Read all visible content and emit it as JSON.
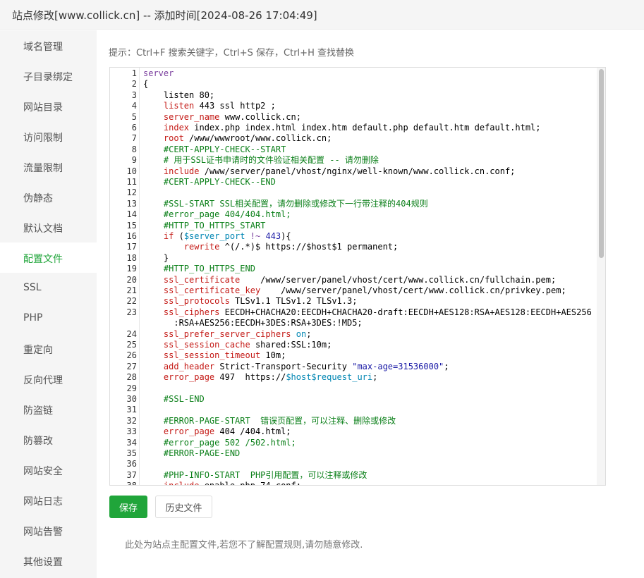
{
  "title": "站点修改[www.collick.cn] -- 添加时间[2024-08-26 17:04:49]",
  "sidebar": {
    "items": [
      {
        "label": "域名管理"
      },
      {
        "label": "子目录绑定"
      },
      {
        "label": "网站目录"
      },
      {
        "label": "访问限制"
      },
      {
        "label": "流量限制"
      },
      {
        "label": "伪静态"
      },
      {
        "label": "默认文档"
      },
      {
        "label": "配置文件",
        "active": true
      },
      {
        "label": "SSL"
      },
      {
        "label": "PHP"
      },
      {
        "label": "重定向"
      },
      {
        "label": "反向代理"
      },
      {
        "label": "防盗链"
      },
      {
        "label": "防篡改"
      },
      {
        "label": "网站安全"
      },
      {
        "label": "网站日志"
      },
      {
        "label": "网站告警"
      },
      {
        "label": "其他设置"
      }
    ]
  },
  "hint": "提示：Ctrl+F 搜索关键字，Ctrl+S 保存，Ctrl+H 查找替换",
  "editor": {
    "lines": [
      {
        "n": "1",
        "parts": [
          [
            "kw",
            "server"
          ]
        ]
      },
      {
        "n": "2",
        "parts": [
          [
            "",
            "{"
          ]
        ]
      },
      {
        "n": "3",
        "parts": [
          [
            "",
            "    listen 80;"
          ]
        ]
      },
      {
        "n": "4",
        "parts": [
          [
            "",
            "    "
          ],
          [
            "dir",
            "listen"
          ],
          [
            "",
            " 443 ssl http2 ;"
          ]
        ]
      },
      {
        "n": "5",
        "parts": [
          [
            "",
            "    "
          ],
          [
            "dir",
            "server_name"
          ],
          [
            "",
            " www.collick.cn;"
          ]
        ]
      },
      {
        "n": "6",
        "parts": [
          [
            "",
            "    "
          ],
          [
            "dir",
            "index"
          ],
          [
            "",
            " index.php index.html index.htm default.php default.htm default.html;"
          ]
        ]
      },
      {
        "n": "7",
        "parts": [
          [
            "",
            "    "
          ],
          [
            "dir",
            "root"
          ],
          [
            "",
            " /www/wwwroot/www.collick.cn;"
          ]
        ]
      },
      {
        "n": "8",
        "parts": [
          [
            "cm",
            "    #CERT-APPLY-CHECK--START"
          ]
        ]
      },
      {
        "n": "9",
        "parts": [
          [
            "cm",
            "    # 用于SSL证书申请时的文件验证相关配置 -- 请勿删除"
          ]
        ]
      },
      {
        "n": "10",
        "parts": [
          [
            "",
            "    "
          ],
          [
            "dir",
            "include"
          ],
          [
            "",
            " /www/server/panel/vhost/nginx/well-known/www.collick.cn.conf;"
          ]
        ]
      },
      {
        "n": "11",
        "parts": [
          [
            "cm",
            "    #CERT-APPLY-CHECK--END"
          ]
        ]
      },
      {
        "n": "12",
        "parts": [
          [
            "",
            ""
          ]
        ]
      },
      {
        "n": "13",
        "parts": [
          [
            "cm",
            "    #SSL-START SSL相关配置，请勿删除或修改下一行带注释的404规则"
          ]
        ]
      },
      {
        "n": "14",
        "parts": [
          [
            "cm",
            "    #error_page 404/404.html;"
          ]
        ]
      },
      {
        "n": "15",
        "parts": [
          [
            "cm",
            "    #HTTP_TO_HTTPS_START"
          ]
        ]
      },
      {
        "n": "16",
        "parts": [
          [
            "",
            "    "
          ],
          [
            "dir",
            "if"
          ],
          [
            "",
            " ("
          ],
          [
            "var",
            "$server_port"
          ],
          [
            "",
            " "
          ],
          [
            "kw",
            "!~"
          ],
          [
            "",
            " "
          ],
          [
            "num",
            "443"
          ],
          [
            "",
            "){"
          ]
        ]
      },
      {
        "n": "17",
        "parts": [
          [
            "",
            "        "
          ],
          [
            "dir",
            "rewrite"
          ],
          [
            "",
            " ^(/.*)$ https://$host$1 permanent;"
          ]
        ]
      },
      {
        "n": "18",
        "parts": [
          [
            "",
            "    }"
          ]
        ]
      },
      {
        "n": "19",
        "parts": [
          [
            "cm",
            "    #HTTP_TO_HTTPS_END"
          ]
        ]
      },
      {
        "n": "20",
        "parts": [
          [
            "",
            "    "
          ],
          [
            "dir",
            "ssl_certificate"
          ],
          [
            "",
            "    /www/server/panel/vhost/cert/www.collick.cn/fullchain.pem;"
          ]
        ]
      },
      {
        "n": "21",
        "parts": [
          [
            "",
            "    "
          ],
          [
            "dir",
            "ssl_certificate_key"
          ],
          [
            "",
            "    /www/server/panel/vhost/cert/www.collick.cn/privkey.pem;"
          ]
        ]
      },
      {
        "n": "22",
        "parts": [
          [
            "",
            "    "
          ],
          [
            "dir",
            "ssl_protocols"
          ],
          [
            "",
            " TLSv1.1 TLSv1.2 TLSv1.3;"
          ]
        ]
      },
      {
        "n": "23",
        "parts": [
          [
            "",
            "    "
          ],
          [
            "dir",
            "ssl_ciphers"
          ],
          [
            "",
            " EECDH+CHACHA20:EECDH+CHACHA20-draft:EECDH+AES128:RSA+AES128:EECDH+AES256"
          ]
        ]
      },
      {
        "n": "",
        "parts": [
          [
            "",
            "      :RSA+AES256:EECDH+3DES:RSA+3DES:!MD5;"
          ]
        ]
      },
      {
        "n": "24",
        "parts": [
          [
            "",
            "    "
          ],
          [
            "dir",
            "ssl_prefer_server_ciphers"
          ],
          [
            "",
            " "
          ],
          [
            "var",
            "on"
          ],
          [
            "",
            ";"
          ]
        ]
      },
      {
        "n": "25",
        "parts": [
          [
            "",
            "    "
          ],
          [
            "dir",
            "ssl_session_cache"
          ],
          [
            "",
            " shared:SSL:10m;"
          ]
        ]
      },
      {
        "n": "26",
        "parts": [
          [
            "",
            "    "
          ],
          [
            "dir",
            "ssl_session_timeout"
          ],
          [
            "",
            " 10m;"
          ]
        ]
      },
      {
        "n": "27",
        "parts": [
          [
            "",
            "    "
          ],
          [
            "dir",
            "add_header"
          ],
          [
            "",
            " Strict-Transport-Security "
          ],
          [
            "str",
            "\"max-age=31536000\""
          ],
          [
            "",
            ";"
          ]
        ]
      },
      {
        "n": "28",
        "parts": [
          [
            "",
            "    "
          ],
          [
            "dir",
            "error_page"
          ],
          [
            "",
            " 497  https://"
          ],
          [
            "var",
            "$host$request_uri"
          ],
          [
            "",
            ";"
          ]
        ]
      },
      {
        "n": "29",
        "parts": [
          [
            "",
            ""
          ]
        ]
      },
      {
        "n": "30",
        "parts": [
          [
            "cm",
            "    #SSL-END"
          ]
        ]
      },
      {
        "n": "31",
        "parts": [
          [
            "",
            ""
          ]
        ]
      },
      {
        "n": "32",
        "parts": [
          [
            "cm",
            "    #ERROR-PAGE-START  错误页配置，可以注释、删除或修改"
          ]
        ]
      },
      {
        "n": "33",
        "parts": [
          [
            "",
            "    "
          ],
          [
            "dir",
            "error_page"
          ],
          [
            "",
            " 404 /404.html;"
          ]
        ]
      },
      {
        "n": "34",
        "parts": [
          [
            "cm",
            "    #error_page 502 /502.html;"
          ]
        ]
      },
      {
        "n": "35",
        "parts": [
          [
            "cm",
            "    #ERROR-PAGE-END"
          ]
        ]
      },
      {
        "n": "36",
        "parts": [
          [
            "",
            ""
          ]
        ]
      },
      {
        "n": "37",
        "parts": [
          [
            "cm",
            "    #PHP-INFO-START  PHP引用配置，可以注释或修改"
          ]
        ]
      },
      {
        "n": "38",
        "parts": [
          [
            "",
            "    "
          ],
          [
            "dir",
            "include"
          ],
          [
            "",
            " enable-php-74.conf;"
          ]
        ]
      }
    ]
  },
  "buttons": {
    "save": "保存",
    "history": "历史文件"
  },
  "footnote": "此处为站点主配置文件,若您不了解配置规则,请勿随意修改."
}
